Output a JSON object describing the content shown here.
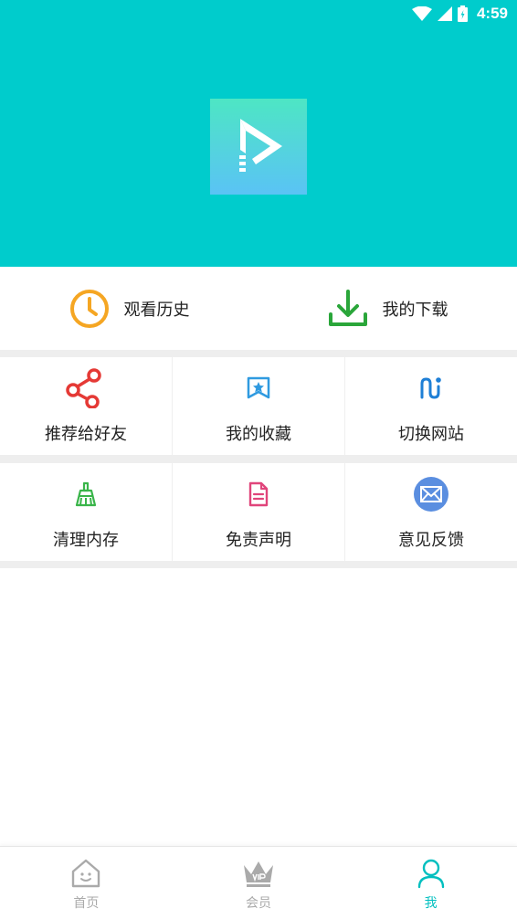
{
  "status_bar": {
    "time": "4:59",
    "icons": [
      "wifi-icon",
      "cell-signal-icon",
      "battery-icon"
    ]
  },
  "theme": {
    "header_bg": "#00cccc",
    "accent": "#00bfbf"
  },
  "header": {
    "logo_icon": "app-logo-play-icon"
  },
  "quick_actions": [
    {
      "label": "观看历史",
      "icon": "clock-icon",
      "color": "#f5a623"
    },
    {
      "label": "我的下载",
      "icon": "download-icon",
      "color": "#2aa63a"
    }
  ],
  "menu_row1": [
    {
      "label": "推荐给好友",
      "icon": "share-icon",
      "color": "#e53935"
    },
    {
      "label": "我的收藏",
      "icon": "bookmark-star-icon",
      "color": "#2f9ae0"
    },
    {
      "label": "切换网站",
      "icon": "switch-route-icon",
      "color": "#1e7fd6"
    }
  ],
  "menu_row2": [
    {
      "label": "清理内存",
      "icon": "broom-icon",
      "color": "#3ab54a"
    },
    {
      "label": "免责声明",
      "icon": "document-icon",
      "color": "#e0457b"
    },
    {
      "label": "意见反馈",
      "icon": "mail-icon",
      "color": "#5a8ee0"
    }
  ],
  "tabbar": [
    {
      "label": "首页",
      "icon": "home-icon",
      "active": false
    },
    {
      "label": "会员",
      "icon": "vip-crown-icon",
      "active": false
    },
    {
      "label": "我",
      "icon": "user-icon",
      "active": true
    }
  ]
}
